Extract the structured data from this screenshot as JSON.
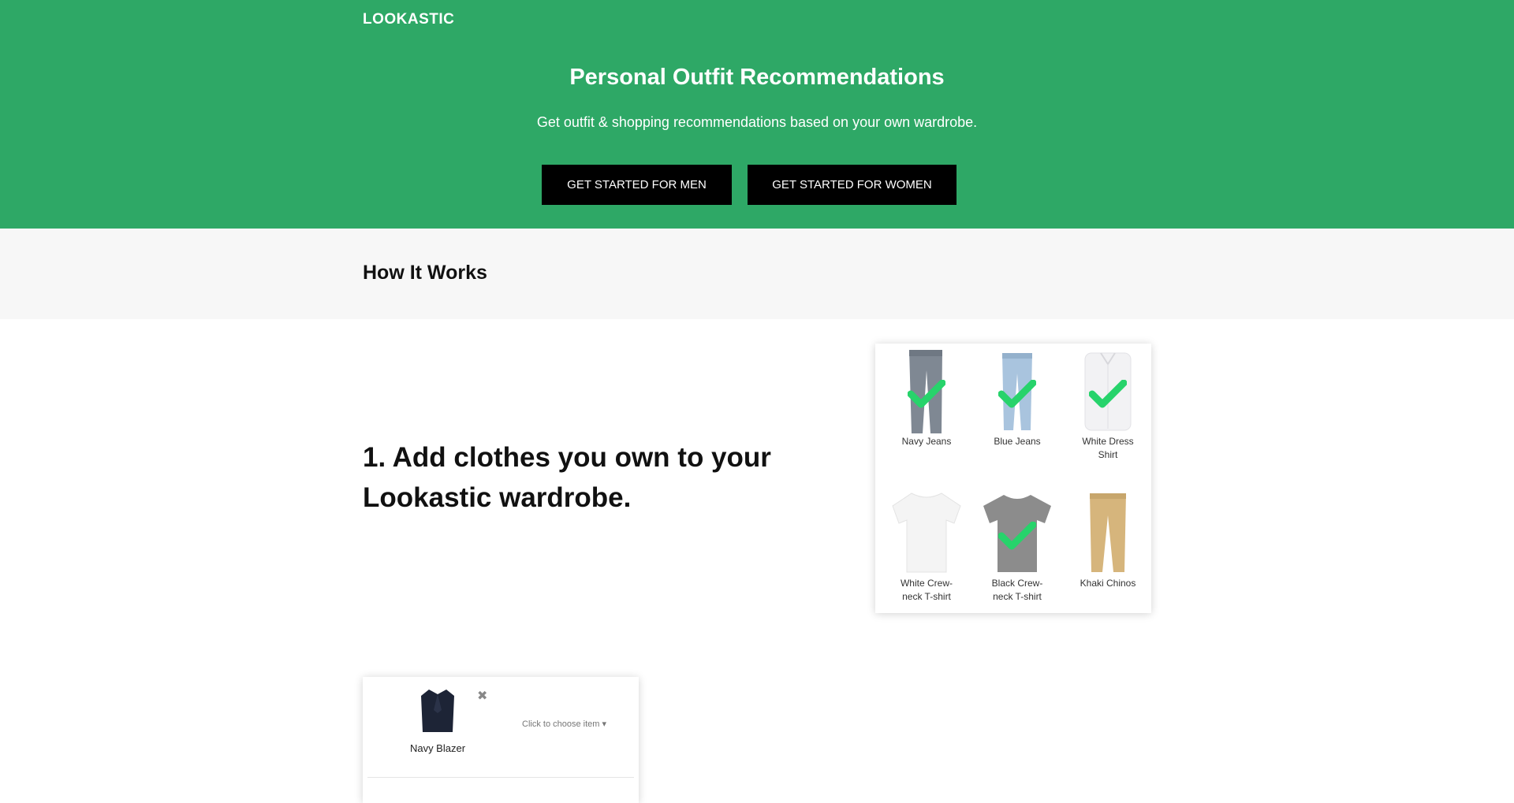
{
  "brand": "LOOKASTIC",
  "hero": {
    "title": "Personal Outfit Recommendations",
    "subtitle": "Get outfit & shopping recommendations based on your own wardrobe.",
    "btn_men": "GET STARTED FOR MEN",
    "btn_women": "GET STARTED FOR WOMEN"
  },
  "how_it_works": {
    "title": "How It Works"
  },
  "step1": {
    "title": "1. Add clothes you own to your Lookastic wardrobe."
  },
  "wardrobe": {
    "items": [
      {
        "label": "Navy Jeans",
        "checked": true,
        "icon": "navy-jeans-icon"
      },
      {
        "label": "Blue Jeans",
        "checked": true,
        "icon": "blue-jeans-icon"
      },
      {
        "label": "White Dress Shirt",
        "checked": true,
        "icon": "white-dress-shirt-icon"
      },
      {
        "label": "White Crew-neck T-shirt",
        "checked": false,
        "icon": "white-tshirt-icon"
      },
      {
        "label": "Black Crew-neck T-shirt",
        "checked": true,
        "icon": "black-tshirt-icon"
      },
      {
        "label": "Khaki Chinos",
        "checked": false,
        "icon": "khaki-chinos-icon"
      }
    ]
  },
  "outfit_card": {
    "item_label": "Navy Blazer",
    "remove_symbol": "✖",
    "choose_text": "Click to choose item ▾"
  },
  "colors": {
    "accent": "#2ea866",
    "check": "#27d36b"
  }
}
